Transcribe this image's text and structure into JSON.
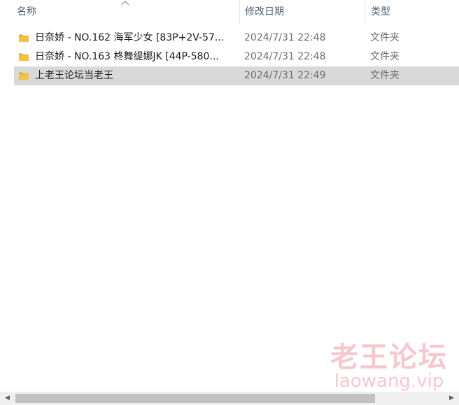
{
  "columns": {
    "name": "名称",
    "date": "修改日期",
    "type": "类型",
    "sort_icon": "sort-up-icon"
  },
  "files": [
    {
      "name": "日奈娇 - NO.162 海军少女 [83P+2V-57...",
      "date": "2024/7/31 22:48",
      "type": "文件夹",
      "icon": "folder-icon",
      "selected": false
    },
    {
      "name": "日奈娇 - NO.163 柊舞缇娜JK [44P-580...",
      "date": "2024/7/31 22:48",
      "type": "文件夹",
      "icon": "folder-icon",
      "selected": false
    },
    {
      "name": "上老王论坛当老王",
      "date": "2024/7/31 22:49",
      "type": "文件夹",
      "icon": "folder-icon",
      "selected": true
    }
  ],
  "watermark": {
    "title": "老王论坛",
    "url": "laowang.vip"
  },
  "colors": {
    "selected_row": "#d9d9d9",
    "header_text": "#4c607a",
    "folder": "#f4c143",
    "watermark": "#f7c7cf"
  }
}
